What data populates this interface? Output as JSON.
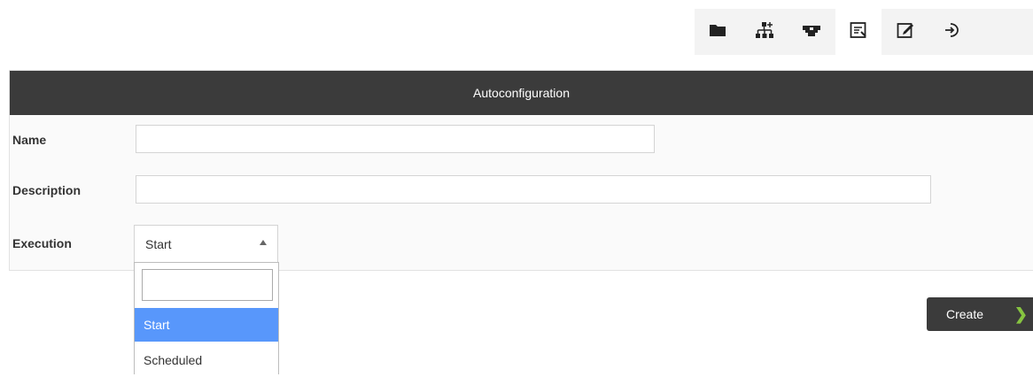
{
  "toolbar": {
    "items": [
      {
        "icon": "folder-icon"
      },
      {
        "icon": "network-add-icon"
      },
      {
        "icon": "plugin-icon"
      },
      {
        "icon": "report-icon"
      },
      {
        "icon": "edit-icon"
      },
      {
        "icon": "exit-icon"
      }
    ]
  },
  "panel": {
    "title": "Autoconfiguration",
    "name_label": "Name",
    "name_value": "",
    "description_label": "Description",
    "description_value": "",
    "execution_label": "Execution",
    "execution_selected": "Start"
  },
  "dropdown": {
    "search_value": "",
    "options": [
      {
        "label": "Start",
        "selected": true
      },
      {
        "label": "Scheduled",
        "selected": false
      }
    ]
  },
  "actions": {
    "create_label": "Create"
  },
  "colors": {
    "header_bg": "#3b3b3b",
    "selected_option": "#5897fb",
    "accent_green": "#86c440"
  }
}
